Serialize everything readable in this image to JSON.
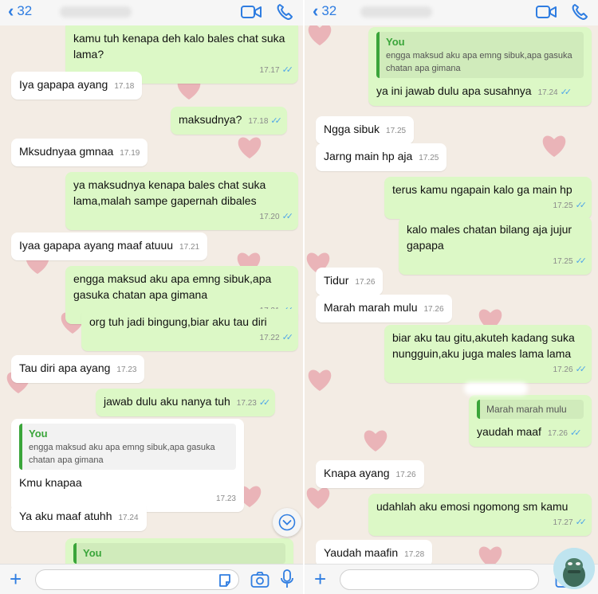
{
  "colors": {
    "accent": "#2f7de1",
    "outgoing": "#dcf8c6",
    "incoming": "#ffffff",
    "quote": "#3aa53a",
    "read_ticks": "#4fa6e8",
    "heart": "#eab4b8"
  },
  "icons": [
    "chevron-left-icon",
    "video-call-icon",
    "phone-icon",
    "plus-icon",
    "sticker-icon",
    "camera-icon",
    "microphone-icon",
    "chevron-down-icon"
  ],
  "left": {
    "header": {
      "back_count": "32"
    },
    "messages": [
      {
        "text": "kamu tuh kenapa deh kalo bales chat suka lama?",
        "time": "17.17"
      },
      {
        "text": "Iya gapapa ayang",
        "time": "17.18"
      },
      {
        "text": "maksudnya?",
        "time": "17.18"
      },
      {
        "text": "Mksudnyaa gmnaa",
        "time": "17.19"
      },
      {
        "text": "ya maksudnya kenapa bales chat suka lama,malah sampe gapernah dibales",
        "time": "17.20"
      },
      {
        "text": "Iyaa gapapa ayang maaf atuuu",
        "time": "17.21"
      },
      {
        "text": "engga maksud aku apa emng sibuk,apa gasuka chatan apa gimana",
        "time": "17.21"
      },
      {
        "text": "org tuh jadi bingung,biar aku tau diri",
        "time": "17.22"
      },
      {
        "text": "Tau diri apa ayang",
        "time": "17.23"
      },
      {
        "text": "jawab dulu aku nanya tuh",
        "time": "17.23"
      },
      {
        "quote_author": "You",
        "quote_text": "engga maksud aku apa emng sibuk,apa gasuka chatan apa gimana",
        "text": "Kmu knapaa",
        "time": "17.23"
      },
      {
        "text": "Ya aku maaf atuhh",
        "time": "17.24"
      },
      {
        "quote_author": "You"
      }
    ]
  },
  "right": {
    "header": {
      "back_count": "32"
    },
    "messages": [
      {
        "quote_author": "You",
        "quote_text": "engga maksud aku apa emng sibuk,apa gasuka chatan apa gimana",
        "text": "ya ini jawab dulu apa susahnya",
        "time": "17.24"
      },
      {
        "text": "Ngga sibuk",
        "time": "17.25"
      },
      {
        "text": "Jarng main hp aja",
        "time": "17.25"
      },
      {
        "text": "terus kamu ngapain kalo ga main hp",
        "time": "17.25"
      },
      {
        "text": "kalo males chatan bilang aja jujur gapapa",
        "time": "17.25"
      },
      {
        "text": "Tidur",
        "time": "17.26"
      },
      {
        "text": "Marah marah mulu",
        "time": "17.26"
      },
      {
        "text": "biar aku tau gitu,akuteh kadang suka nungguin,aku juga males lama lama",
        "time": "17.26"
      },
      {
        "quote_text": "Marah marah mulu",
        "text": "yaudah maaf",
        "time": "17.26"
      },
      {
        "text": "Knapa ayang",
        "time": "17.26"
      },
      {
        "text": "udahlah aku emosi ngomong sm kamu",
        "time": "17.27"
      },
      {
        "text": "Yaudah maafin",
        "time": "17.28"
      }
    ]
  }
}
